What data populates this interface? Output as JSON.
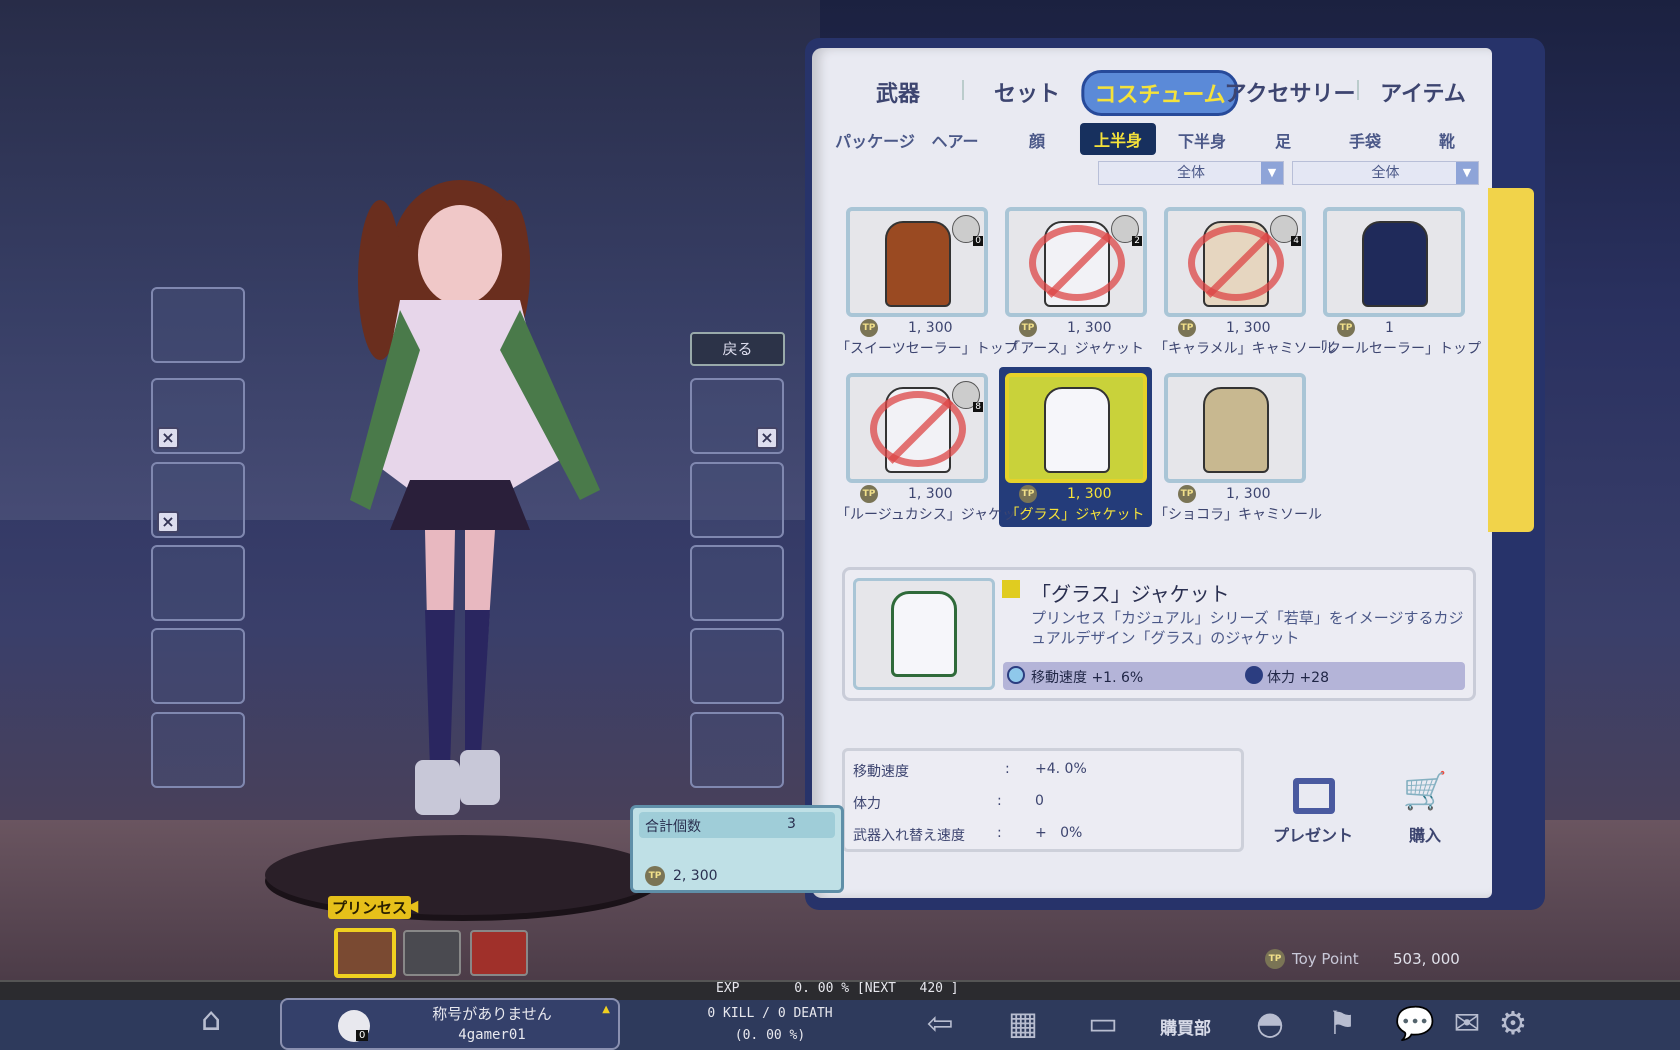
{
  "main_tabs": [
    {
      "label": "武器"
    },
    {
      "label": "セット"
    },
    {
      "label": "コスチューム",
      "active": true
    },
    {
      "label": "アクセサリー"
    },
    {
      "label": "アイテム"
    }
  ],
  "sub_tabs": [
    {
      "label": "パッケージ"
    },
    {
      "label": "ヘアー"
    },
    {
      "label": "顔"
    },
    {
      "label": "上半身",
      "active": true
    },
    {
      "label": "下半身"
    },
    {
      "label": "足"
    },
    {
      "label": "手袋"
    },
    {
      "label": "靴"
    }
  ],
  "filters": [
    {
      "value": "全体"
    },
    {
      "value": "全体"
    }
  ],
  "back_label": "戻る",
  "items": [
    {
      "name": "「スイーツセーラー」トップ",
      "price": "1, 300",
      "badge": "0",
      "color": "#9a4a22",
      "unavailable": false
    },
    {
      "name": "「アース」ジャケット",
      "price": "1, 300",
      "badge": "2",
      "color": "#f2f2f6",
      "unavailable": true
    },
    {
      "name": "「キャラメル」キャミソール",
      "price": "1, 300",
      "badge": "4",
      "color": "#e6d6c0",
      "unavailable": true
    },
    {
      "name": "「クールセーラー」トップ",
      "price": "1",
      "badge": "",
      "color": "#1f2a5a",
      "unavailable": false
    },
    {
      "name": "「ルージュカシス」ジャケット",
      "price": "1, 300",
      "badge": "8",
      "color": "#f2f2f6",
      "unavailable": true
    },
    {
      "name": "「グラス」ジャケット",
      "price": "1, 300",
      "badge": "",
      "color": "#f6f6fa",
      "unavailable": false,
      "selected": true
    },
    {
      "name": "「ショコラ」キャミソール",
      "price": "1, 300",
      "badge": "",
      "color": "#c8b890",
      "unavailable": false
    }
  ],
  "currency_icon": "TP",
  "detail": {
    "title": "「グラス」ジャケット",
    "description": "プリンセス「カジュアル」シリーズ「若草」をイメージするカジュアルデザイン「グラス」のジャケット",
    "stat1": "移動速度 +1. 6%",
    "stat2": "体力 +28",
    "rarity_color": "#e0cc20"
  },
  "totals": [
    {
      "label": "移動速度",
      "value": "+4. 0%"
    },
    {
      "label": "体力",
      "value": "0"
    },
    {
      "label": "武器入れ替え速度",
      "value": "+   0%"
    }
  ],
  "present_label": "プレゼント",
  "buy_label": "購入",
  "cart": {
    "count_label": "合計個数",
    "count": "3",
    "total": "2, 300"
  },
  "toy_point": {
    "label": "Toy Point",
    "value": "503, 000"
  },
  "character": {
    "class_label": "プリンセス"
  },
  "status": {
    "exp": "EXP       0. 00 % [NEXT   420 ]",
    "title": "称号がありません",
    "player": "4gamer01",
    "kills": "0 KILL / 0 DEATH",
    "ratio": "(0. 00 %)",
    "rank": "0",
    "shop_label": "購買部"
  }
}
